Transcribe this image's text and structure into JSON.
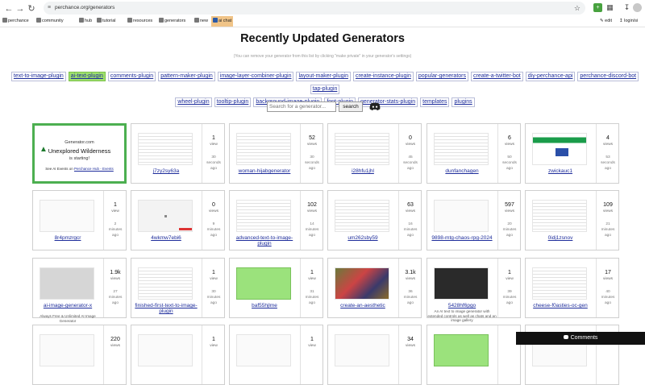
{
  "browser": {
    "url": "perchance.org/generators",
    "bookmarks": [
      {
        "label": "perchance",
        "icon": "perchance-icon"
      },
      {
        "label": "community",
        "icon": "community-icon"
      },
      {
        "label": "hub",
        "icon": "hub-icon"
      },
      {
        "label": "tutorial",
        "icon": "tutorial-icon"
      },
      {
        "label": "resources",
        "icon": "resources-icon"
      },
      {
        "label": "generators",
        "icon": "generators-icon"
      },
      {
        "label": "new",
        "icon": "new-icon"
      },
      {
        "label": "ai chat",
        "icon": "chat-icon"
      }
    ],
    "bookmarks_right": {
      "edit": "edit",
      "login": "login/si"
    }
  },
  "page": {
    "title": "Recently Updated Generators",
    "subtitle": "(You can remove your generator from this list by clicking \"make private\" in your generator's settings)"
  },
  "plugins": {
    "row1": [
      "text-to-image-plugin",
      "ai-text-plugin",
      "comments-plugin",
      "pattern-maker-plugin",
      "image-layer-combiner-plugin",
      "layout-maker-plugin",
      "create-instance-plugin",
      "popular-generators",
      "create-a-twitter-bot",
      "diy-perchance-api",
      "perchance-discord-bot",
      "tap-plugin"
    ],
    "row2": [
      "wheel-plugin",
      "tooltip-plugin",
      "background-image-plugin",
      "font-plugin",
      "generator-stats-plugin",
      "templates",
      "plugins"
    ],
    "highlighted": "ai-text-plugin"
  },
  "search": {
    "placeholder": "Search for a generator...",
    "button": "search"
  },
  "ad": {
    "line1": "Generator.com",
    "line2": "Unexplored Wilderness",
    "line3": "is starting!",
    "line4_prefix": "See AI Events on",
    "line4_link": "Perchance Hub - Events"
  },
  "cards": [
    {
      "name": "j7zy2sy63a",
      "views": "1",
      "age": [
        "30",
        "seconds",
        "ago"
      ],
      "thumb": "lines"
    },
    {
      "name": "woman-hijabgenerator",
      "views": "52",
      "age": [
        "30",
        "seconds",
        "ago"
      ],
      "thumb": "lines"
    },
    {
      "name": "i28hfu1jhl",
      "views": "0",
      "age": [
        "45",
        "seconds",
        "ago"
      ],
      "thumb": "lines"
    },
    {
      "name": "dunfanchagen",
      "views": "6",
      "age": [
        "50",
        "seconds",
        "ago"
      ],
      "thumb": "lines"
    },
    {
      "name": "zwickauc1",
      "views": "4",
      "age": [
        "53",
        "seconds",
        "ago"
      ],
      "thumb": "banner"
    },
    {
      "name": "8r4pmzrgcr",
      "views": "1",
      "age": [
        "2",
        "minutes",
        "ago"
      ],
      "thumb": "blank"
    },
    {
      "name": "4wkmw7ebi6",
      "views": "0",
      "age": [
        "9",
        "minutes",
        "ago"
      ],
      "thumb": "dot"
    },
    {
      "name": "advanced-text-to-image-plugin",
      "views": "102",
      "age": [
        "14",
        "minutes",
        "ago"
      ],
      "thumb": "lines"
    },
    {
      "name": "um262sby59",
      "views": "63",
      "age": [
        "16",
        "minutes",
        "ago"
      ],
      "thumb": "lines"
    },
    {
      "name": "9898-mtg-chaos-rpg-2024",
      "views": "597",
      "age": [
        "20",
        "minutes",
        "ago"
      ],
      "thumb": "blank"
    },
    {
      "name": "0idj1zsnov",
      "views": "109",
      "age": [
        "21",
        "minutes",
        "ago"
      ],
      "thumb": "lines"
    },
    {
      "name": "ai-image-generator-x",
      "views": "1.9k",
      "age": [
        "27",
        "minutes",
        "ago"
      ],
      "thumb": "gray",
      "desc": "Always Free & Unlimited AI Image Generator"
    },
    {
      "name": "finished-first-text-to-image-plugin",
      "views": "1",
      "age": [
        "30",
        "minutes",
        "ago"
      ],
      "thumb": "lines"
    },
    {
      "name": "baf55hjlme",
      "views": "1",
      "age": [
        "31",
        "minutes",
        "ago"
      ],
      "thumb": "green"
    },
    {
      "name": "create-an-aesthetic",
      "views": "3.1k",
      "age": [
        "36",
        "minutes",
        "ago"
      ],
      "thumb": "photo"
    },
    {
      "name": "5428hf6pgo",
      "views": "1",
      "age": [
        "39",
        "minutes",
        "ago"
      ],
      "thumb": "dark",
      "desc": "An AI text to image generator with extended controls as well as chats and an image gallery"
    },
    {
      "name": "cheese-f0asties-oc-gen",
      "views": "17",
      "age": [
        "40",
        "minutes",
        "ago"
      ],
      "thumb": "lines"
    },
    {
      "name": "",
      "views": "220",
      "age": [
        "",
        "",
        ""
      ],
      "thumb": "blank"
    },
    {
      "name": "",
      "views": "1",
      "age": [
        "",
        "",
        ""
      ],
      "thumb": "blank"
    },
    {
      "name": "",
      "views": "1",
      "age": [
        "",
        "",
        ""
      ],
      "thumb": "blank"
    },
    {
      "name": "",
      "views": "34",
      "age": [
        "",
        "",
        ""
      ],
      "thumb": "blank"
    },
    {
      "name": "",
      "views": "",
      "age": [
        "",
        "",
        ""
      ],
      "thumb": "green"
    },
    {
      "name": "",
      "views": "",
      "age": [
        "",
        "",
        ""
      ],
      "thumb": "blank"
    }
  ],
  "view_label": "view",
  "views_label": "views",
  "comments_label": "Comments"
}
